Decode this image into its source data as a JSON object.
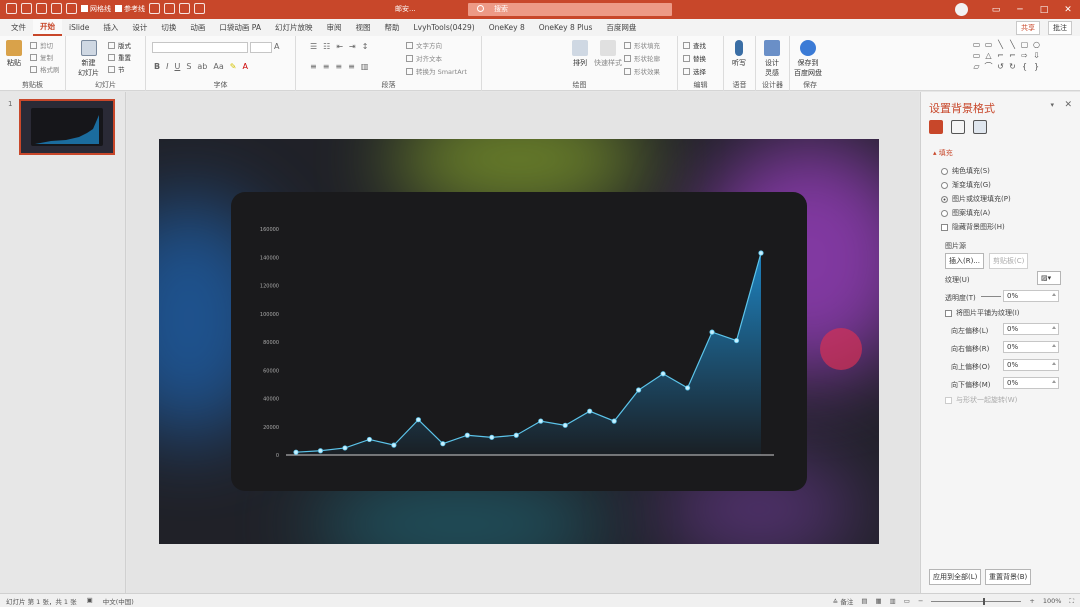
{
  "titlebar": {
    "autosave_label": "网格线",
    "guides_label": "参考线",
    "doc_title": "邮安...",
    "search_placeholder": "搜索",
    "controls": [
      "─",
      "□",
      "✕"
    ]
  },
  "ribbon_tabs": [
    "文件",
    "开始",
    "iSlide",
    "插入",
    "设计",
    "切换",
    "动画",
    "口袋动画 PA",
    "幻灯片放映",
    "审阅",
    "视图",
    "帮助",
    "LvyhTools(0429)",
    "OneKey 8",
    "OneKey 8 Plus",
    "百度网盘"
  ],
  "ribbon_right": {
    "share": "共享",
    "comment": "批注"
  },
  "clipboard": {
    "paste": "粘贴",
    "cut": "剪切",
    "copy": "复制",
    "format_painter": "格式刷",
    "label": "剪贴板"
  },
  "slides_group": {
    "new_slide": "新建\n幻灯片",
    "layout": "版式",
    "reset": "重置",
    "section": "节",
    "label": "幻灯片"
  },
  "font_group": {
    "bold": "B",
    "italic": "I",
    "underline": "U",
    "strike": "S",
    "label": "字体"
  },
  "para_group": {
    "text_dir": "文字方向",
    "align_text": "对齐文本",
    "smartart": "转换为 SmartArt",
    "label": "段落"
  },
  "draw_group": {
    "arrange": "排列",
    "quick_styles": "快速样式",
    "fill": "形状填充",
    "outline": "形状轮廓",
    "effects": "形状效果",
    "label": "绘图"
  },
  "edit_group": {
    "find": "查找",
    "replace": "替换",
    "select": "选择",
    "label": "编辑"
  },
  "voice_group": {
    "dictate": "听写",
    "label": "语音"
  },
  "designer_group": {
    "ideas": "设计\n灵感",
    "label": "设计器"
  },
  "save_group": {
    "save": "保存到\n百度网盘",
    "label": "保存"
  },
  "thumb": {
    "number": "1"
  },
  "panel": {
    "title": "设置背景格式",
    "fill_section": "填充",
    "options": [
      "纯色填充(S)",
      "渐变填充(G)",
      "图片或纹理填充(P)",
      "图案填充(A)"
    ],
    "selected_option": 2,
    "hide_bg": "隐藏背景图形(H)",
    "picture_source": "图片源",
    "insert_btn": "插入(R)...",
    "clipboard_btn": "剪贴板(C)",
    "texture": "纹理(U)",
    "transparency": "透明度(T)",
    "transparency_val": "0%",
    "tile": "将图片平铺为纹理(I)",
    "offsets": [
      {
        "label": "向左偏移(L)",
        "value": "0%"
      },
      {
        "label": "向右偏移(R)",
        "value": "0%"
      },
      {
        "label": "向上偏移(O)",
        "value": "0%"
      },
      {
        "label": "向下偏移(M)",
        "value": "0%"
      }
    ],
    "rotate_with_shape": "与形状一起旋转(W)",
    "apply_all": "应用到全部(L)",
    "reset_bg": "重置背景(B)"
  },
  "status": {
    "slide_info": "幻灯片 第 1 张，共 1 张",
    "lang": "中文(中国)",
    "notes": "备注",
    "zoom": "100%"
  },
  "colors": {
    "accent": "#c8472a",
    "line": "#7fd6ee",
    "area_top": "#1e88c8"
  },
  "chart_data": {
    "type": "area",
    "x": [
      1,
      2,
      3,
      4,
      5,
      6,
      7,
      8,
      9,
      10,
      11,
      12,
      13,
      14,
      15,
      16,
      17,
      18,
      19,
      20
    ],
    "values": [
      2000,
      3000,
      5000,
      11000,
      7000,
      25000,
      8000,
      14000,
      12500,
      14000,
      24000,
      21000,
      31000,
      24000,
      46000,
      57500,
      47500,
      87000,
      81000,
      143000
    ],
    "ylim": [
      0,
      160000
    ],
    "yticks": [
      "160000",
      "140000",
      "120000",
      "100000",
      "80000",
      "60000",
      "40000",
      "20000",
      "0"
    ],
    "grid": false
  }
}
